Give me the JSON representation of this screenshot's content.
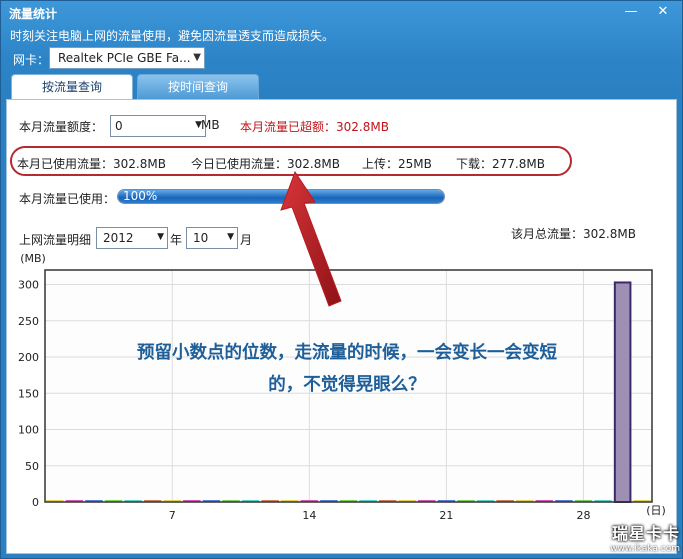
{
  "window": {
    "title": "流量统计",
    "subtitle": "时刻关注电脑上网的流量使用，避免因流量透支而造成损失。",
    "minimize_glyph": "—",
    "close_glyph": "✕"
  },
  "nic": {
    "label": "网卡：",
    "selected": "Realtek PCIe GBE Fa..."
  },
  "tabs": [
    {
      "label": "按流量查询",
      "active": true
    },
    {
      "label": "按时间查询",
      "active": false
    }
  ],
  "quota": {
    "label": "本月流量额度：",
    "value": "0",
    "unit": "MB",
    "exceeded": "本月流量已超额：302.8MB"
  },
  "stats": {
    "month_used": "本月已使用流量：302.8MB",
    "today_used": "今日已使用流量：302.8MB",
    "upload": "上传：25MB",
    "download": "下载：277.8MB"
  },
  "usage": {
    "label": "本月流量已使用：",
    "percent_text": "100%",
    "fraction": 1.0
  },
  "detail": {
    "label": "上网流量明细",
    "year": "2012",
    "year_suffix": "年",
    "month": "10",
    "month_suffix": "月",
    "total": "该月总流量：302.8MB"
  },
  "chart_data": {
    "type": "bar",
    "ylabel": "(MB)",
    "xlabel": "(日)",
    "ylim": [
      0,
      320
    ],
    "yticks": [
      0,
      50,
      100,
      150,
      200,
      250,
      300
    ],
    "xticks": [
      7,
      14,
      21,
      28
    ],
    "days": 31,
    "categories": [
      1,
      2,
      3,
      4,
      5,
      6,
      7,
      8,
      9,
      10,
      11,
      12,
      13,
      14,
      15,
      16,
      17,
      18,
      19,
      20,
      21,
      22,
      23,
      24,
      25,
      26,
      27,
      28,
      29,
      30,
      31
    ],
    "values": [
      0,
      0,
      0,
      0,
      0,
      0,
      0,
      0,
      0,
      0,
      0,
      0,
      0,
      0,
      0,
      0,
      0,
      0,
      0,
      0,
      0,
      0,
      0,
      0,
      0,
      0,
      0,
      0,
      0,
      302.8,
      0
    ],
    "grid": true,
    "bar_color": "#9e8fb4",
    "bar_border": "#3a2a6a",
    "baseline_colors": [
      "#e3d35a",
      "#d35ab2",
      "#5a7ed3",
      "#7ad35a",
      "#5ad3c8",
      "#d3805a"
    ]
  },
  "annotation": {
    "line1": "预留小数点的位数，走流量的时候，一会变长一会变短",
    "line2": "的，不觉得晃眼么？",
    "arrow_color": "#b51d22"
  },
  "watermark": {
    "brand": "瑞星卡卡",
    "url": "www.ikaka.com"
  }
}
